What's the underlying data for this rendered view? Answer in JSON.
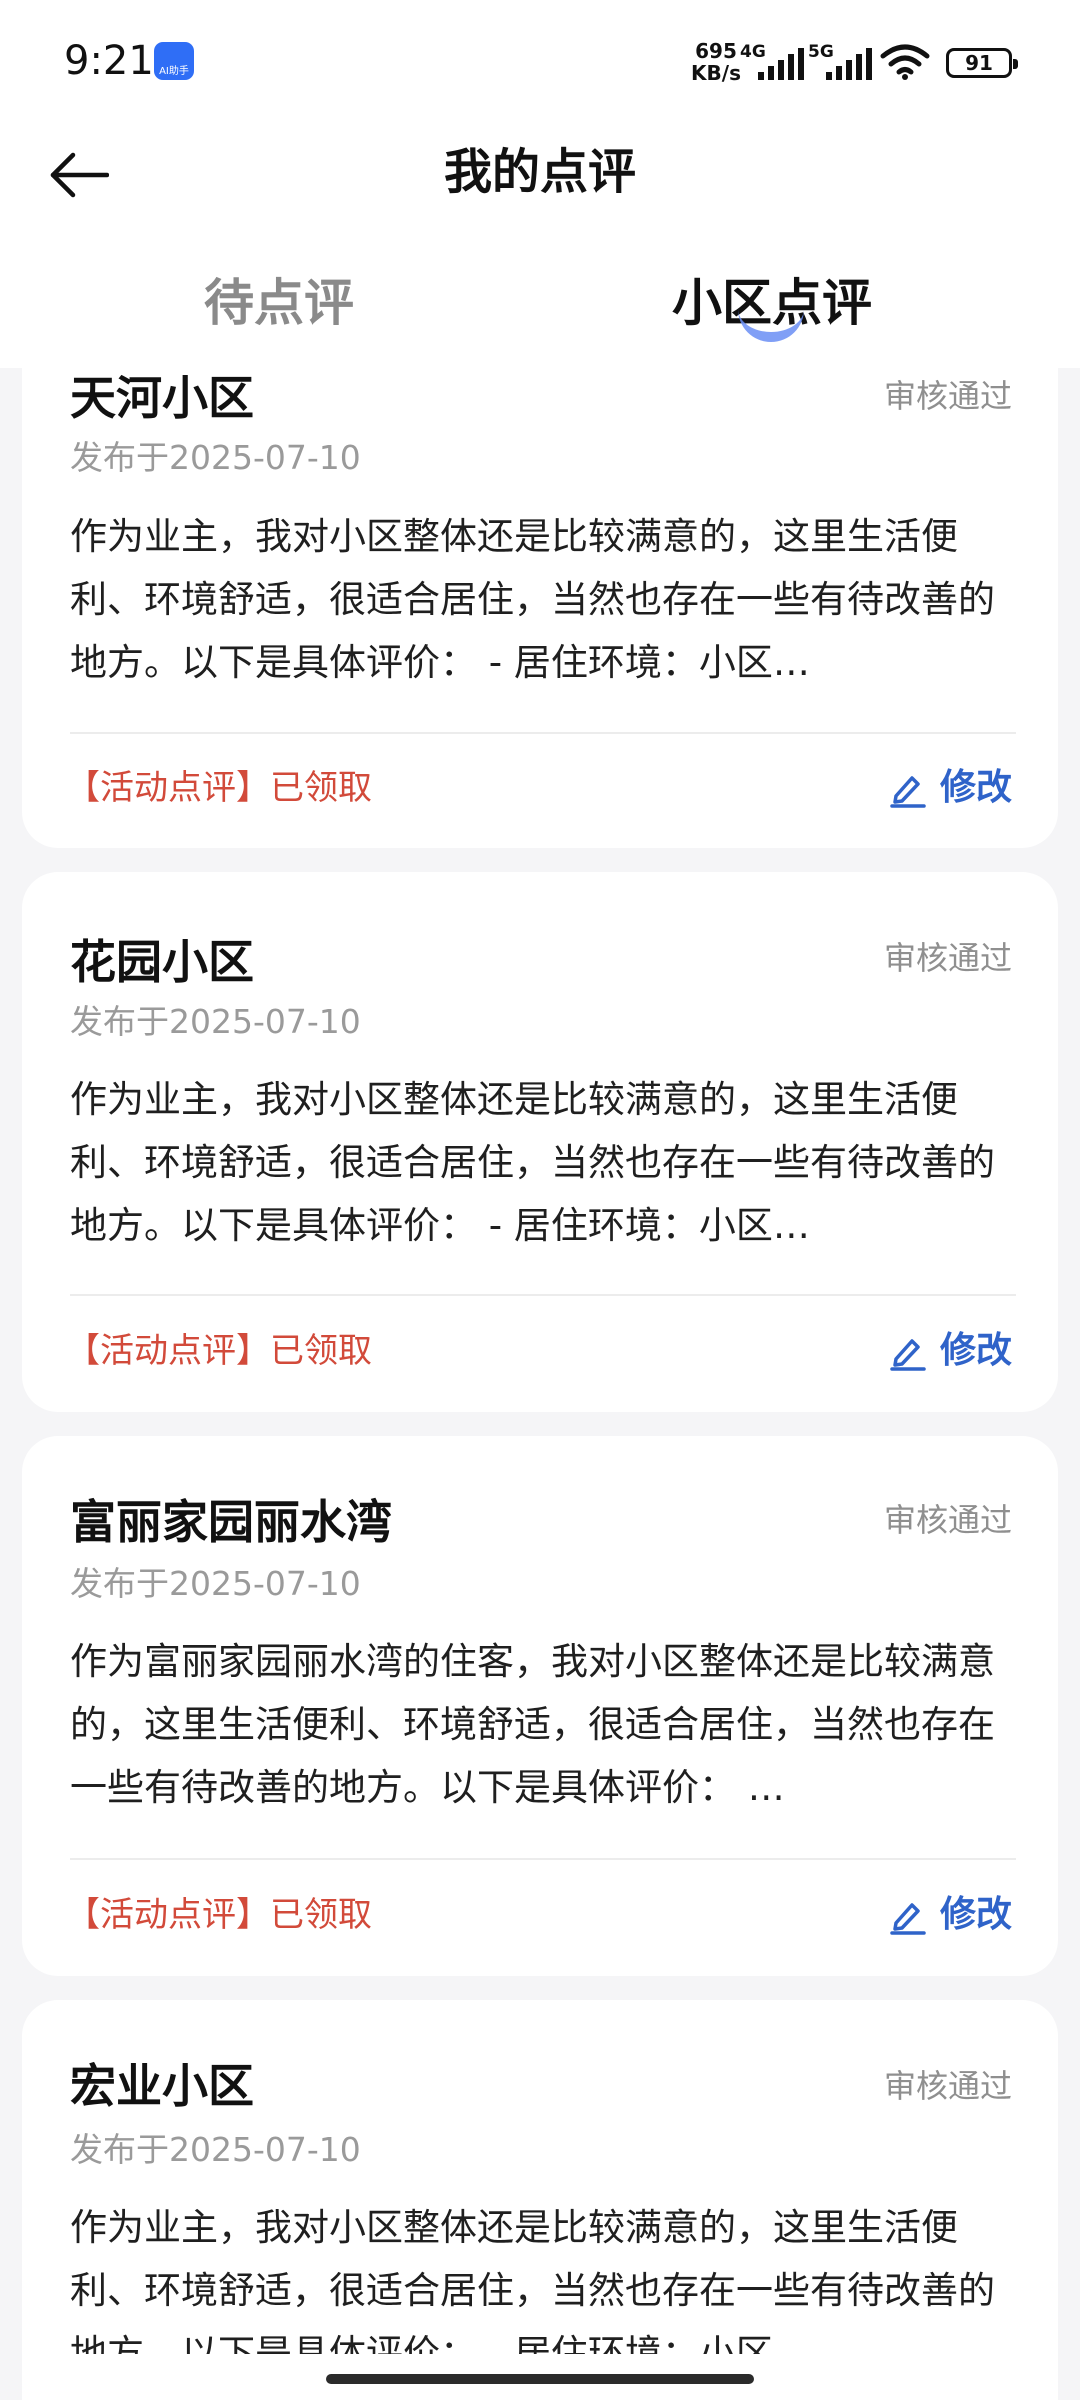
{
  "status_bar": {
    "time": "9:21",
    "app_badge": "AI助手",
    "net_speed_value": "695",
    "net_speed_unit": "KB/s",
    "signal_1_label": "4G",
    "signal_2_label": "5G",
    "battery": "91"
  },
  "header": {
    "title": "我的点评"
  },
  "tabs": [
    {
      "label": "待点评"
    },
    {
      "label": "小区点评"
    }
  ],
  "accent_color": "#2f63c9",
  "tag_color": "#d24a3a",
  "cards": [
    {
      "name": "天河小区",
      "status": "审核通过",
      "date": "发布于2025-07-10",
      "body": "作为业主，我对小区整体还是比较满意的，这里生活便利、环境舒适，很适合居住，当然也存在一些有待改善的地方。以下是具体评价： - 居住环境：小区…",
      "tag": "【活动点评】已领取",
      "edit_label": "修改"
    },
    {
      "name": "花园小区",
      "status": "审核通过",
      "date": "发布于2025-07-10",
      "body": "作为业主，我对小区整体还是比较满意的，这里生活便利、环境舒适，很适合居住，当然也存在一些有待改善的地方。以下是具体评价： - 居住环境：小区…",
      "tag": "【活动点评】已领取",
      "edit_label": "修改"
    },
    {
      "name": "富丽家园丽水湾",
      "status": "审核通过",
      "date": "发布于2025-07-10",
      "body": "作为富丽家园丽水湾的住客，我对小区整体还是比较满意的，这里生活便利、环境舒适，很适合居住，当然也存在一些有待改善的地方。以下是具体评价： …",
      "tag": "【活动点评】已领取",
      "edit_label": "修改"
    },
    {
      "name": "宏业小区",
      "status": "审核通过",
      "date": "发布于2025-07-10",
      "body": "作为业主，我对小区整体还是比较满意的，这里生活便利、环境舒适，很适合居住，当然也存在一些有待改善的地方。以下是具体评价： - 居住环境：小区",
      "tag": "",
      "edit_label": ""
    }
  ]
}
